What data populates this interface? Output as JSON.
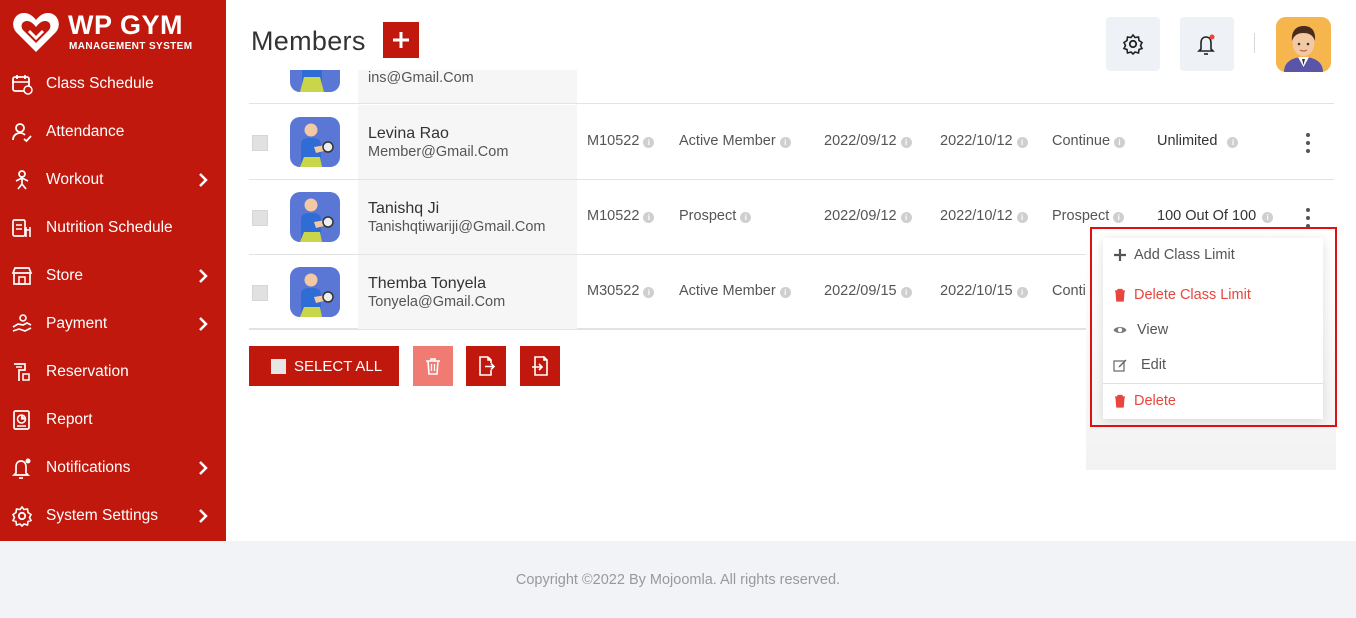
{
  "brand": {
    "title": "WP GYM",
    "subtitle": "MANAGEMENT SYSTEM"
  },
  "sidebar": {
    "items": [
      {
        "label": "Class Schedule",
        "icon": "calendar-icon",
        "has_submenu": false
      },
      {
        "label": "Attendance",
        "icon": "user-check-icon",
        "has_submenu": false
      },
      {
        "label": "Workout",
        "icon": "dumbbell-icon",
        "has_submenu": true
      },
      {
        "label": "Nutrition Schedule",
        "icon": "nutrition-icon",
        "has_submenu": false
      },
      {
        "label": "Store",
        "icon": "store-icon",
        "has_submenu": true
      },
      {
        "label": "Payment",
        "icon": "payment-icon",
        "has_submenu": true
      },
      {
        "label": "Reservation",
        "icon": "reservation-icon",
        "has_submenu": false
      },
      {
        "label": "Report",
        "icon": "report-icon",
        "has_submenu": false
      },
      {
        "label": "Notifications",
        "icon": "bell-icon",
        "has_submenu": true
      },
      {
        "label": "System Settings",
        "icon": "gear-icon",
        "has_submenu": true
      }
    ]
  },
  "header": {
    "title": "Members"
  },
  "table": {
    "partial_email": "ins@Gmail.Com",
    "rows": [
      {
        "name": "Levina Rao",
        "email": "Member@Gmail.Com",
        "member_id": "M10522",
        "type": "Active Member",
        "joined": "2022/09/12",
        "expires": "2022/10/12",
        "status": "Continue",
        "class_limit": "Unlimited"
      },
      {
        "name": "Tanishq Ji",
        "email": "Tanishqtiwariji@Gmail.Com",
        "member_id": "M10522",
        "type": "Prospect",
        "joined": "2022/09/12",
        "expires": "2022/10/12",
        "status": "Prospect",
        "class_limit": "100 Out Of 100"
      },
      {
        "name": "Themba Tonyela",
        "email": "Tonyela@Gmail.Com",
        "member_id": "M30522",
        "type": "Active Member",
        "joined": "2022/09/15",
        "expires": "2022/10/15",
        "status": "Continue",
        "class_limit": ""
      }
    ]
  },
  "actions": {
    "select_all": "SELECT ALL"
  },
  "dropdown": {
    "items": [
      {
        "label": "Add Class Limit",
        "icon": "plus-icon",
        "color": "#555555"
      },
      {
        "label": "Delete Class Limit",
        "icon": "trash-icon",
        "color": "#e8453c"
      },
      {
        "label": "View",
        "icon": "eye-icon",
        "color": "#555555"
      },
      {
        "label": "Edit",
        "icon": "edit-icon",
        "color": "#555555"
      },
      {
        "label": "Delete",
        "icon": "trash-icon",
        "color": "#e8453c"
      }
    ]
  },
  "footer": {
    "text": "Copyright ©2022 By Mojoomla. All rights reserved."
  },
  "colors": {
    "brand_red": "#c0180c",
    "danger": "#e8453c",
    "highlight_outline": "#e01010"
  }
}
